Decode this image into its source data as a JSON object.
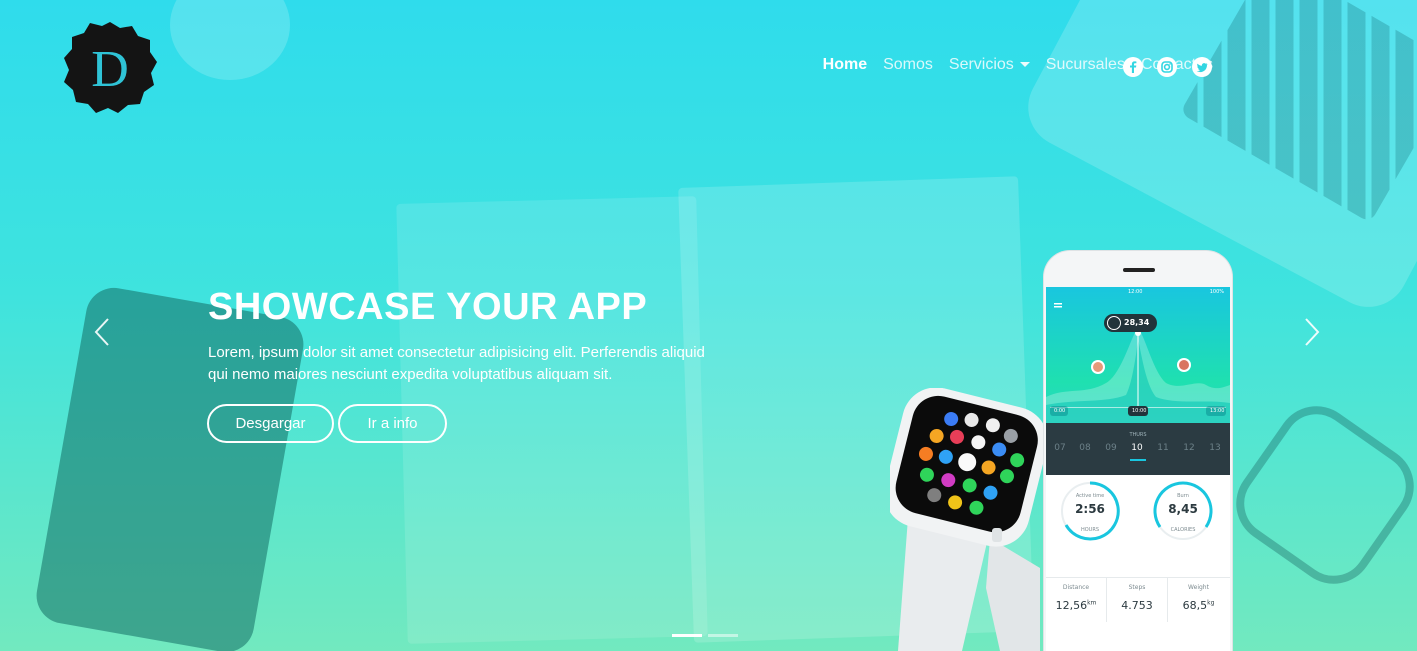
{
  "nav": {
    "items": [
      {
        "label": "Home",
        "active": true
      },
      {
        "label": "Somos"
      },
      {
        "label": "Servicios",
        "dropdown": true
      },
      {
        "label": "Sucursales"
      },
      {
        "label": "Contactos"
      }
    ],
    "social": [
      "facebook-icon",
      "instagram-icon",
      "twitter-icon"
    ]
  },
  "logo": {
    "letter": "D"
  },
  "hero": {
    "title": "SHOWCASE YOUR APP",
    "lead": "Lorem, ipsum dolor sit amet consectetur adipisicing elit. Perferendis aliquid qui nemo maiores nesciunt expedita voluptatibus aliquam sit.",
    "buttons": {
      "primary": "Desgargar",
      "secondary": "Ir a info"
    }
  },
  "carousel": {
    "slides": 2,
    "active": 0
  },
  "app": {
    "status_time": "12:00",
    "status_battery": "100%",
    "bubble_value": "28,34",
    "graph_left": "0:00",
    "graph_mid": "10:00",
    "graph_right": "13:00",
    "day_header": "THURS",
    "days": [
      "07",
      "08",
      "09",
      "10",
      "11",
      "12",
      "13"
    ],
    "active_day": "10",
    "ring1": {
      "label": "Active time",
      "value": "2:56",
      "unit": "HOURS"
    },
    "ring2": {
      "label": "Burn",
      "value": "8,45",
      "unit": "CALORIES"
    },
    "stats": [
      {
        "label": "Distance",
        "value": "12,56",
        "unit": "km"
      },
      {
        "label": "Steps",
        "value": "4.753",
        "unit": ""
      },
      {
        "label": "Weight",
        "value": "68,5",
        "unit": "kg"
      }
    ]
  },
  "colors": {
    "accent": "#2fdcec",
    "accent_bottom": "#72e9bf",
    "logo_bg": "#141414",
    "logo_letter": "#2fc3d6",
    "app_dark": "#2b3b42"
  }
}
